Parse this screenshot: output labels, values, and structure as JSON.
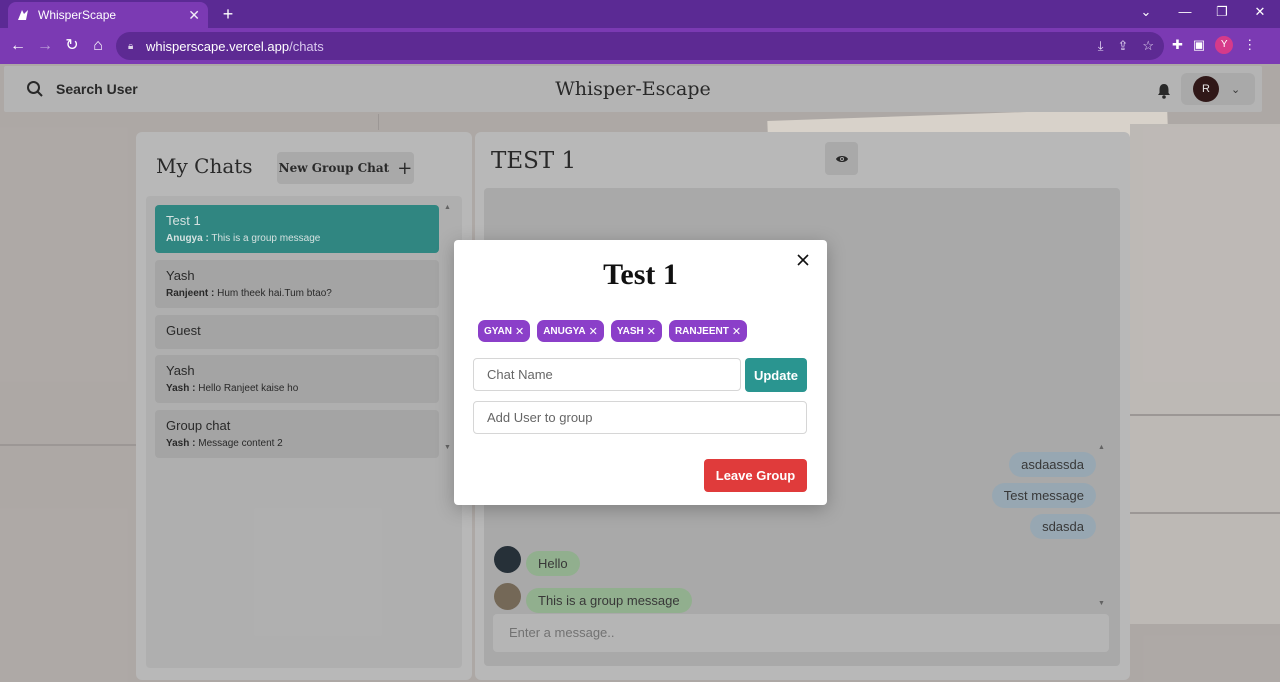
{
  "browser": {
    "tab_title": "WhisperScape",
    "url_host": "whisperscape.vercel.app",
    "url_path": "/chats",
    "profile_initial": "Y",
    "accent": "#7b3ab3"
  },
  "header": {
    "search_label": "Search User",
    "brand": "Whisper-Escape",
    "avatar_initial": "R"
  },
  "chats": {
    "title": "My Chats",
    "new_group_label": "New Group Chat",
    "items": [
      {
        "name": "Test 1",
        "sender": "Anugya :",
        "preview": "This is a group message",
        "active": true
      },
      {
        "name": "Yash",
        "sender": "Ranjeent :",
        "preview": "Hum theek hai.Tum btao?"
      },
      {
        "name": "Guest",
        "sender": "",
        "preview": ""
      },
      {
        "name": "Yash",
        "sender": "Yash :",
        "preview": "Hello Ranjeet kaise ho"
      },
      {
        "name": "Group chat",
        "sender": "Yash :",
        "preview": "Message content 2"
      }
    ]
  },
  "conversation": {
    "title": "TEST 1",
    "messages": [
      {
        "text": "asdaassda",
        "mine": true
      },
      {
        "text": "Test message",
        "mine": true
      },
      {
        "text": "sdasda",
        "mine": true
      },
      {
        "text": "Hello",
        "mine": false
      },
      {
        "text": "This is a group message",
        "mine": false
      }
    ],
    "input_placeholder": "Enter a message.."
  },
  "modal": {
    "title": "Test 1",
    "members": [
      "GYAN",
      "ANUGYA",
      "YASH",
      "RANJEENT"
    ],
    "chat_name_placeholder": "Chat Name",
    "update_label": "Update",
    "add_user_placeholder": "Add User to group",
    "leave_label": "Leave Group",
    "colors": {
      "chip": "#8b3fc9",
      "update": "#2a9590",
      "leave": "#e03b3b"
    }
  }
}
